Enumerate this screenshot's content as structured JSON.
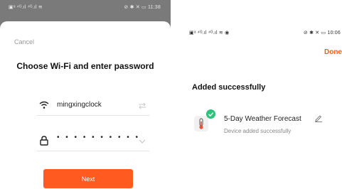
{
  "left_screen": {
    "status_left": "▣ᵃ ⁴ᴳ.ıl ⁴ᴳ.ıl ≋",
    "status_right": "⊘ ✱ ✕ ▭ 11:38",
    "cancel_label": "Cancel",
    "title": "Choose Wi-Fi and enter password",
    "wifi_name": "mingxingclock",
    "password_masked": "• • • • • • • • • •",
    "next_label": "Next",
    "icons": [
      "wifi-icon",
      "switch-arrows-icon",
      "lock-icon",
      "chevron-down-icon"
    ]
  },
  "right_screen": {
    "status_left": "▣ᵃ ⁴ᴳ.ıl ⁴ᴳ.ıl ≋ ◉",
    "status_right": "⊘ ✱ ✕ ▭ 10:06",
    "done_label": "Done",
    "title": "Added successfully",
    "device_name": "5-Day Weather Forecast",
    "device_status": "Device added successfully",
    "icons": [
      "thermometer-icon",
      "check-badge-icon",
      "pencil-icon"
    ]
  },
  "colors": {
    "accent": "#ff5a1f",
    "success": "#2cc37a"
  }
}
